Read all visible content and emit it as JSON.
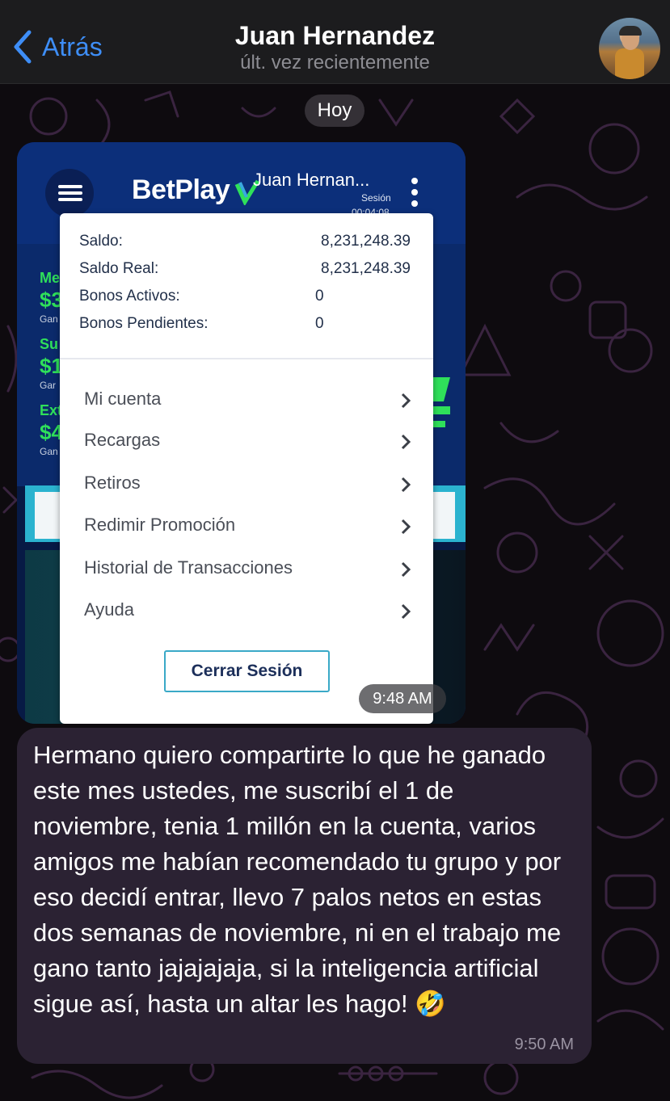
{
  "header": {
    "back_label": "Atrás",
    "contact_name": "Juan Hernandez",
    "status": "últ. vez recientemente"
  },
  "chat": {
    "date_label": "Hoy",
    "image_message": {
      "time": "9:48 AM",
      "screenshot": {
        "brand": "BetPlay",
        "user_name": "Juan Hernan...",
        "session_label": "Sesión",
        "session_timer": "00:04:08",
        "balances": [
          {
            "label": "Saldo:",
            "value": "8,231,248.39"
          },
          {
            "label": "Saldo Real:",
            "value": "8,231,248.39"
          },
          {
            "label": "Bonos Activos:",
            "value": "0"
          },
          {
            "label": "Bonos Pendientes:",
            "value": "0"
          }
        ],
        "menu": [
          {
            "label": "Mi cuenta"
          },
          {
            "label": "Recargas"
          },
          {
            "label": "Retiros"
          },
          {
            "label": "Redimir Promoción"
          },
          {
            "label": "Historial de Transacciones"
          },
          {
            "label": "Ayuda"
          }
        ],
        "logout_label": "Cerrar Sesión",
        "side_labels": [
          "Me",
          "Su",
          "Ext"
        ],
        "side_values": [
          "$3",
          "$1",
          "$4"
        ],
        "side_sub": [
          "Gan",
          "Gar",
          "Gan"
        ],
        "colors": {
          "navy": "#0c2f7a",
          "green": "#2fe05a",
          "teal": "#2bb3cf"
        }
      }
    },
    "text_message": {
      "text": "Hermano quiero compartirte lo que he ganado este mes ustedes, me suscribí el 1 de noviembre, tenia 1 millón en la cuenta, varios amigos me habían recomendado tu grupo y por eso decidí entrar, llevo 7 palos netos en estas dos semanas de noviembre, ni en el trabajo me gano tanto jajajajaja, si  la inteligencia artificial sigue así, hasta un altar les hago! 🤣",
      "time": "9:50 AM"
    }
  },
  "colors": {
    "accent": "#3e8ef7",
    "bubble": "#2b2233",
    "header_bg": "#1c1c1e"
  }
}
